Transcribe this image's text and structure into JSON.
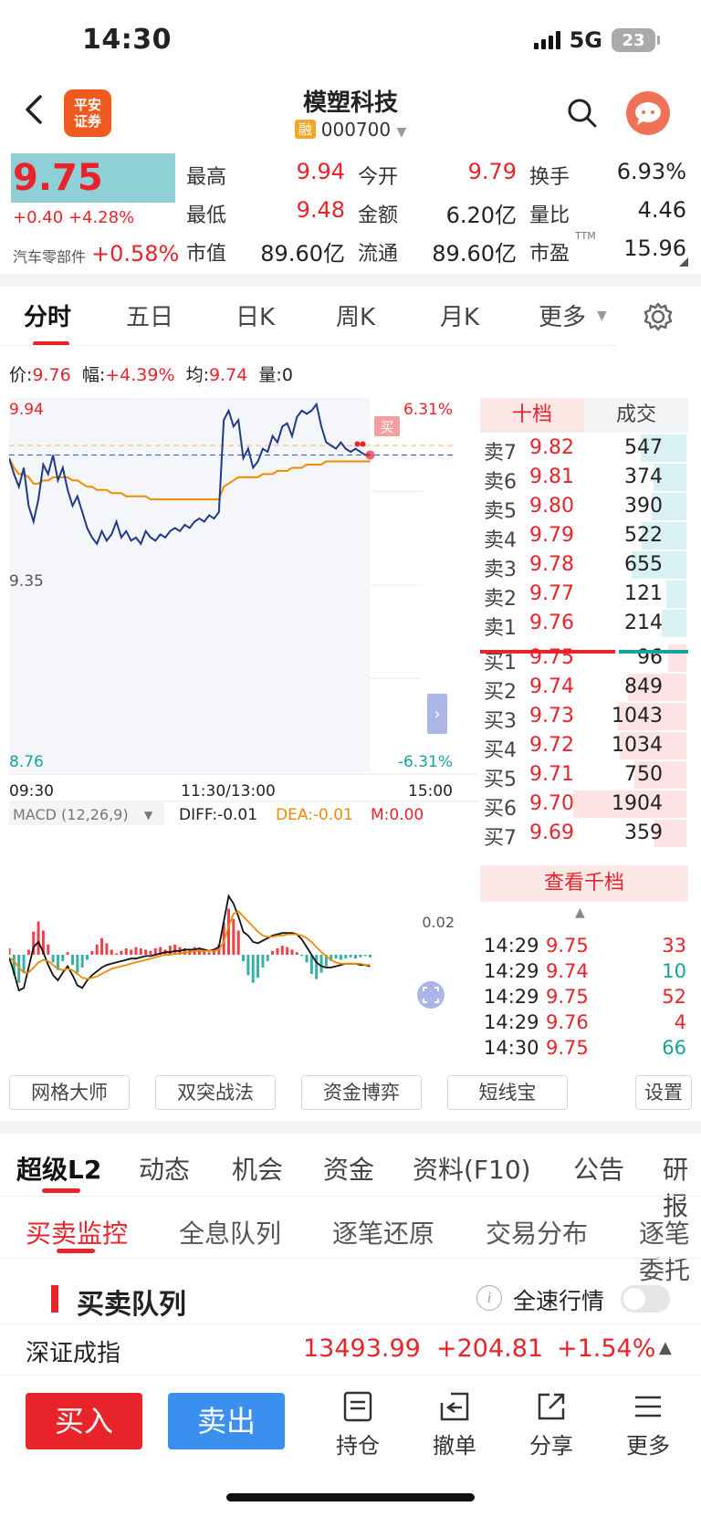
{
  "status_bar": {
    "time": "14:30",
    "network": "5G",
    "battery": "23"
  },
  "header": {
    "title": "模塑科技",
    "badge": "融",
    "code": "000700",
    "logo_text": "平安\n证券"
  },
  "quote": {
    "price": "9.75",
    "change": "+0.40",
    "change_pct": "+4.28%",
    "sector_name": "汽车零部件",
    "sector_pct": "+0.58%",
    "fields": [
      {
        "label": "最高",
        "value": "9.94",
        "color": "red"
      },
      {
        "label": "今开",
        "value": "9.79",
        "color": "red"
      },
      {
        "label": "换手",
        "value": "6.93%",
        "color": "dark"
      },
      {
        "label": "最低",
        "value": "9.48",
        "color": "red"
      },
      {
        "label": "金额",
        "value": "6.20亿",
        "color": "dark"
      },
      {
        "label": "量比",
        "value": "4.46",
        "color": "dark"
      },
      {
        "label": "市值",
        "value": "89.60亿",
        "color": "dark"
      },
      {
        "label": "流通",
        "value": "89.60亿",
        "color": "dark"
      },
      {
        "label": "市盈",
        "value": "15.96",
        "color": "dark",
        "sup": "TTM"
      }
    ]
  },
  "tabs": [
    "分时",
    "五日",
    "日K",
    "周K",
    "月K",
    "更多"
  ],
  "chart_info": {
    "price_lbl": "价:",
    "price": "9.76",
    "amp_lbl": "幅:",
    "amp": "+4.39%",
    "avg_lbl": "均:",
    "avg": "9.74",
    "vol_lbl": "量:",
    "vol": "0"
  },
  "chart_data": {
    "type": "line",
    "y_max_label": "9.94",
    "y_mid_label": "9.35",
    "y_min_label": "8.76",
    "pct_max_label": "6.31%",
    "pct_min_label": "-6.31%",
    "ylim": [
      8.76,
      9.94
    ],
    "prev_close": 9.35,
    "x_labels": [
      "09:30",
      "11:30/13:00",
      "15:00"
    ],
    "buy_marker": "买",
    "price_series": [
      9.75,
      9.7,
      9.66,
      9.72,
      9.6,
      9.55,
      9.62,
      9.73,
      9.7,
      9.76,
      9.68,
      9.72,
      9.65,
      9.6,
      9.63,
      9.58,
      9.53,
      9.5,
      9.48,
      9.52,
      9.49,
      9.51,
      9.55,
      9.5,
      9.52,
      9.49,
      9.5,
      9.48,
      9.52,
      9.5,
      9.49,
      9.51,
      9.5,
      9.52,
      9.53,
      9.52,
      9.54,
      9.53,
      9.55,
      9.56,
      9.55,
      9.57,
      9.56,
      9.58,
      9.87,
      9.9,
      9.85,
      9.87,
      9.75,
      9.78,
      9.72,
      9.74,
      9.78,
      9.77,
      9.82,
      9.8,
      9.85,
      9.86,
      9.82,
      9.88,
      9.9,
      9.89,
      9.9,
      9.92,
      9.85,
      9.8,
      9.79,
      9.78,
      9.8,
      9.78,
      9.77,
      9.78,
      9.77,
      9.76,
      9.76
    ],
    "avg_series": [
      9.75,
      9.72,
      9.7,
      9.7,
      9.69,
      9.67,
      9.67,
      9.68,
      9.68,
      9.69,
      9.69,
      9.69,
      9.69,
      9.68,
      9.68,
      9.67,
      9.66,
      9.66,
      9.65,
      9.65,
      9.65,
      9.64,
      9.64,
      9.64,
      9.63,
      9.63,
      9.63,
      9.63,
      9.63,
      9.62,
      9.62,
      9.62,
      9.62,
      9.62,
      9.62,
      9.62,
      9.62,
      9.62,
      9.62,
      9.62,
      9.62,
      9.62,
      9.62,
      9.62,
      9.66,
      9.67,
      9.68,
      9.69,
      9.69,
      9.69,
      9.69,
      9.69,
      9.7,
      9.7,
      9.7,
      9.71,
      9.71,
      9.71,
      9.72,
      9.72,
      9.72,
      9.73,
      9.73,
      9.73,
      9.73,
      9.74,
      9.74,
      9.74,
      9.74,
      9.74,
      9.74,
      9.74,
      9.74,
      9.74,
      9.74
    ],
    "macd": {
      "label": "MACD (12,26,9)",
      "diff": "DIFF:-0.01",
      "dea": "DEA:-0.01",
      "m": "M:0.00",
      "scale_label": "0.02",
      "hist": [
        0.5,
        -1.6,
        -2.2,
        -1.4,
        0.4,
        1.8,
        2.6,
        1.9,
        0.8,
        -0.6,
        -1.2,
        -0.5,
        0.2,
        -0.8,
        -1.4,
        -1.0,
        -0.4,
        0.3,
        0.8,
        1.3,
        0.9,
        0.4,
        0.1,
        0.3,
        0.5,
        0.4,
        0.6,
        0.5,
        0.4,
        0.3,
        0.5,
        0.6,
        0.4,
        0.7,
        0.8,
        0.6,
        0.5,
        0.4,
        0.6,
        0.5,
        0.3,
        0.2,
        0.4,
        0.8,
        2.5,
        3.6,
        2.8,
        1.9,
        -0.5,
        -1.6,
        -2.2,
        -1.8,
        -1.0,
        -0.5,
        0.3,
        0.5,
        0.7,
        0.6,
        0.4,
        0.2,
        -0.1,
        -0.6,
        -1.5,
        -1.9,
        -1.4,
        -0.9,
        -0.5,
        -0.3,
        -0.4,
        -0.3,
        -0.2,
        -0.3,
        -0.2,
        -0.1,
        -0.2
      ],
      "diff_series": [
        -0.2,
        -1.4,
        -2.8,
        -2.6,
        -1.0,
        0.6,
        1.0,
        0.2,
        -0.8,
        -1.6,
        -2.0,
        -1.4,
        -0.9,
        -1.6,
        -2.4,
        -2.6,
        -2.0,
        -1.6,
        -1.3,
        -1.0,
        -0.8,
        -0.7,
        -0.6,
        -0.5,
        -0.4,
        -0.3,
        -0.3,
        -0.2,
        -0.1,
        -0.1,
        0.0,
        0.1,
        0.2,
        0.2,
        0.3,
        0.3,
        0.4,
        0.4,
        0.4,
        0.5,
        0.4,
        0.3,
        0.4,
        0.6,
        2.6,
        4.6,
        4.0,
        3.0,
        1.8,
        1.5,
        1.0,
        0.9,
        1.1,
        1.3,
        1.5,
        1.6,
        1.7,
        1.7,
        1.7,
        1.6,
        1.2,
        0.6,
        0.0,
        -0.6,
        -0.9,
        -1.0,
        -1.0,
        -0.9,
        -0.8,
        -0.7,
        -0.7,
        -0.7,
        -0.8,
        -0.8,
        -0.9
      ],
      "dea_series": [
        -0.2,
        -0.5,
        -1.0,
        -1.4,
        -1.4,
        -1.0,
        -0.6,
        -0.4,
        -0.5,
        -0.8,
        -1.1,
        -1.2,
        -1.1,
        -1.2,
        -1.5,
        -1.8,
        -1.9,
        -1.8,
        -1.7,
        -1.5,
        -1.3,
        -1.1,
        -1.0,
        -0.9,
        -0.8,
        -0.7,
        -0.6,
        -0.5,
        -0.4,
        -0.3,
        -0.2,
        -0.1,
        0.0,
        0.0,
        0.1,
        0.1,
        0.2,
        0.2,
        0.3,
        0.3,
        0.3,
        0.3,
        0.3,
        0.4,
        1.0,
        2.2,
        3.2,
        3.4,
        3.0,
        2.6,
        2.2,
        1.8,
        1.5,
        1.4,
        1.4,
        1.5,
        1.5,
        1.6,
        1.6,
        1.6,
        1.5,
        1.3,
        1.0,
        0.6,
        0.2,
        -0.1,
        -0.4,
        -0.6,
        -0.7,
        -0.7,
        -0.7,
        -0.7,
        -0.7,
        -0.8,
        -0.8
      ]
    }
  },
  "orderbook": {
    "tab_active": "十档",
    "tab_other": "成交",
    "asks": [
      {
        "label": "卖7",
        "price": "9.82",
        "vol": "547",
        "frac": 0.33
      },
      {
        "label": "卖6",
        "price": "9.81",
        "vol": "374",
        "frac": 0.2
      },
      {
        "label": "卖5",
        "price": "9.80",
        "vol": "390",
        "frac": 0.22
      },
      {
        "label": "卖4",
        "price": "9.79",
        "vol": "522",
        "frac": 0.32
      },
      {
        "label": "卖3",
        "price": "9.78",
        "vol": "655",
        "frac": 0.42
      },
      {
        "label": "卖2",
        "price": "9.77",
        "vol": "121",
        "frac": 0.07
      },
      {
        "label": "卖1",
        "price": "9.76",
        "vol": "214",
        "frac": 0.12
      }
    ],
    "bids": [
      {
        "label": "买1",
        "price": "9.75",
        "vol": "96",
        "frac": 0.05
      },
      {
        "label": "买2",
        "price": "9.74",
        "vol": "849",
        "frac": 0.45
      },
      {
        "label": "买3",
        "price": "9.73",
        "vol": "1043",
        "frac": 0.55
      },
      {
        "label": "买4",
        "price": "9.72",
        "vol": "1034",
        "frac": 0.54
      },
      {
        "label": "买5",
        "price": "9.71",
        "vol": "750",
        "frac": 0.39
      },
      {
        "label": "买6",
        "price": "9.70",
        "vol": "1904",
        "frac": 1.0
      },
      {
        "label": "买7",
        "price": "9.69",
        "vol": "359",
        "frac": 0.19
      }
    ],
    "view_more": "查看千档",
    "trades": [
      {
        "time": "14:29",
        "price": "9.75",
        "vol": "33",
        "color": "red"
      },
      {
        "time": "14:29",
        "price": "9.74",
        "vol": "10",
        "color": "green"
      },
      {
        "time": "14:29",
        "price": "9.75",
        "vol": "52",
        "color": "red"
      },
      {
        "time": "14:29",
        "price": "9.76",
        "vol": "4",
        "color": "red"
      },
      {
        "time": "14:30",
        "price": "9.75",
        "vol": "66",
        "color": "green"
      }
    ]
  },
  "tools": [
    "网格大师",
    "双突战法",
    "资金博弈",
    "短线宝",
    "设置"
  ],
  "section_tabs": [
    "超级L2",
    "动态",
    "机会",
    "资金",
    "资料(F10)",
    "公告",
    "研报"
  ],
  "sub_tabs": [
    "买卖监控",
    "全息队列",
    "逐笔还原",
    "交易分布",
    "逐笔委托"
  ],
  "queue": {
    "title": "买卖队列",
    "toggle_label": "全速行情"
  },
  "index": {
    "name": "深证成指",
    "value": "13493.99",
    "change": "+204.81",
    "pct": "+1.54%"
  },
  "bottom": {
    "buy": "买入",
    "sell": "卖出",
    "items": [
      "持仓",
      "撤单",
      "分享",
      "更多"
    ]
  },
  "colors": {
    "up": "#e8232a",
    "down": "#14a39a",
    "price_line": "#1f3a8a",
    "avg_line": "#f08a00",
    "sell_btn": "#3b8fef"
  }
}
